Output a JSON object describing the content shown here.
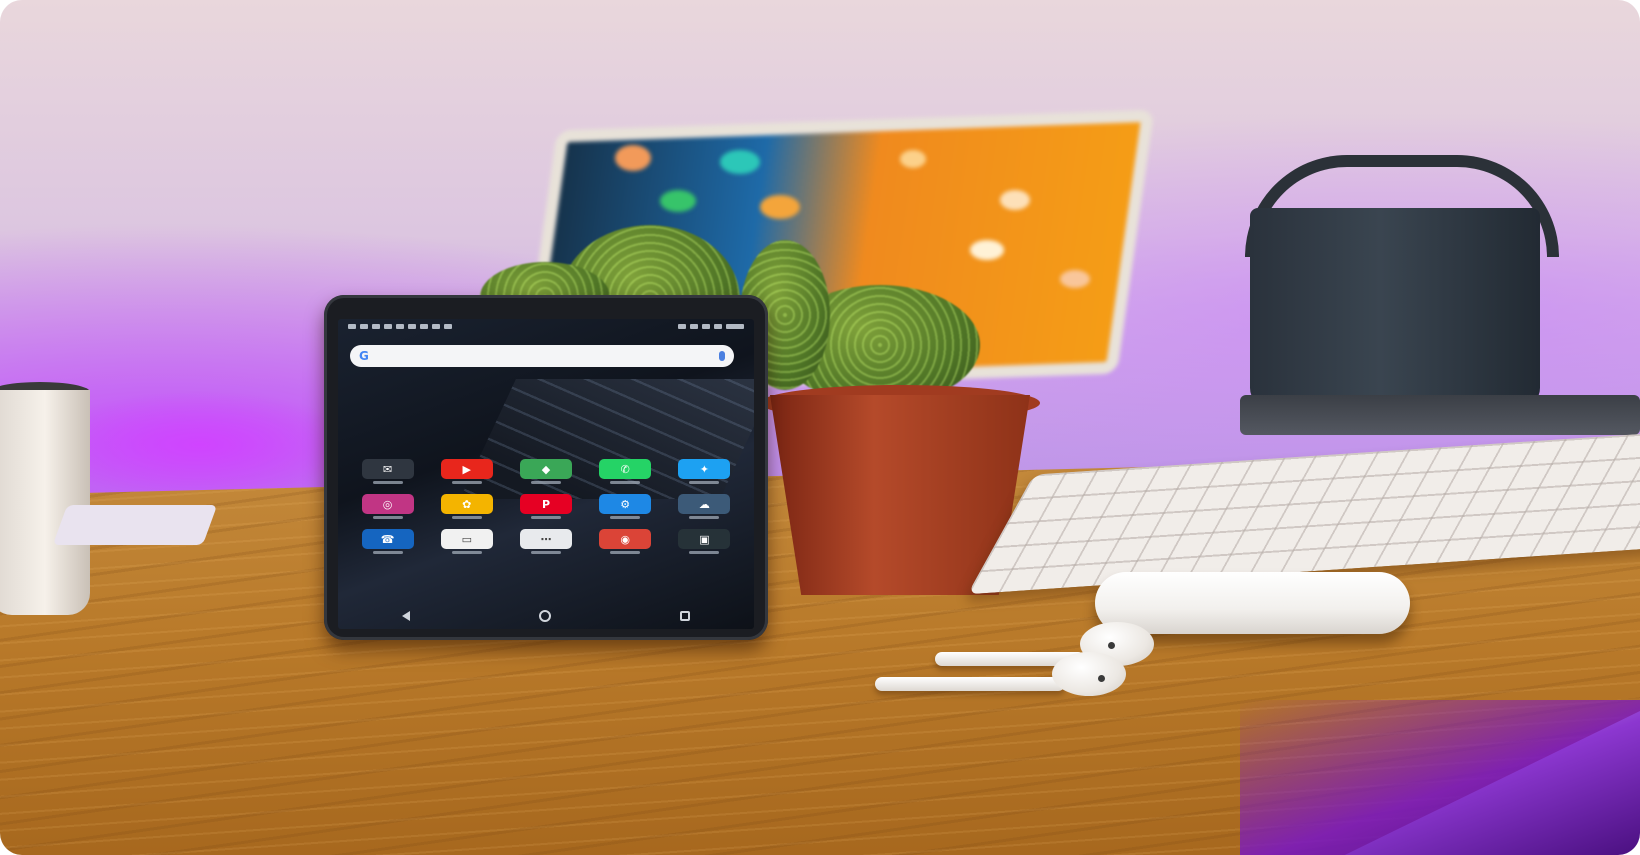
{
  "scene": {
    "description_tags": [
      "smartphone",
      "desk",
      "cactus",
      "wireless-earbuds",
      "keyboard",
      "speaker",
      "tablet"
    ]
  },
  "phone": {
    "search_logo": "G",
    "apps": [
      {
        "name": "Gmail",
        "icon": "mail-icon",
        "color": "#2f3640",
        "glyph": "✉"
      },
      {
        "name": "YouTube",
        "icon": "youtube-icon",
        "color": "#e8261c",
        "glyph": "▶"
      },
      {
        "name": "Maps",
        "icon": "maps-icon",
        "color": "#3aa757",
        "glyph": "◆"
      },
      {
        "name": "WhatsApp",
        "icon": "whatsapp-icon",
        "color": "#25d366",
        "glyph": "✆"
      },
      {
        "name": "Twitter",
        "icon": "twitter-icon",
        "color": "#1da1f2",
        "glyph": "✦"
      },
      {
        "name": "Instagram",
        "icon": "instagram-icon",
        "color": "#c13584",
        "glyph": "◎"
      },
      {
        "name": "Photos",
        "icon": "photos-icon",
        "color": "#f4b400",
        "glyph": "✿"
      },
      {
        "name": "Pinterest",
        "icon": "pinterest-icon",
        "color": "#e60023",
        "glyph": "P"
      },
      {
        "name": "Settings",
        "icon": "gear-icon",
        "color": "#1e88e5",
        "glyph": "⚙"
      },
      {
        "name": "Weather",
        "icon": "weather-icon",
        "color": "#3c5a78",
        "glyph": "☁"
      },
      {
        "name": "Phone",
        "icon": "phone-icon",
        "color": "#1565c0",
        "glyph": "☎"
      },
      {
        "name": "Messages",
        "icon": "messages-icon",
        "color": "#f1f1f1",
        "glyph": "▭"
      },
      {
        "name": "Apps",
        "icon": "app-drawer-icon",
        "color": "#e8eaed",
        "glyph": "⋯"
      },
      {
        "name": "Chrome",
        "icon": "chrome-icon",
        "color": "#db4437",
        "glyph": "◉"
      },
      {
        "name": "Camera",
        "icon": "camera-icon",
        "color": "#263238",
        "glyph": "▣"
      }
    ]
  },
  "colors": {
    "wall": "#dcc6e0",
    "desk": "#b97a2a",
    "accent_purple": "#c43cff"
  }
}
